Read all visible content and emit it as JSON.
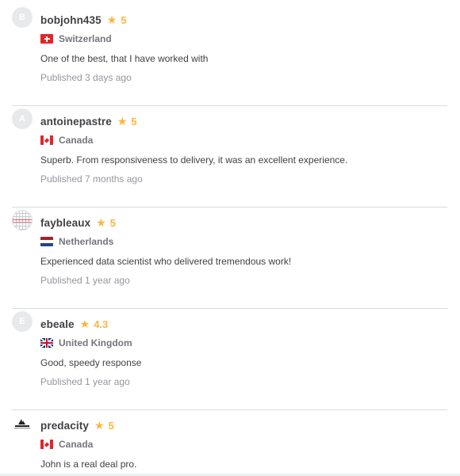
{
  "reviews": [
    {
      "avatar_letter": "B",
      "username": "bobjohn435",
      "rating": "5",
      "country": "Switzerland",
      "flag": "switzerland-flag",
      "text": "One of the best, that I have worked with",
      "published": "Published 3 days ago"
    },
    {
      "avatar_letter": "A",
      "username": "antoinepastre",
      "rating": "5",
      "country": "Canada",
      "flag": "canada-flag",
      "text": "Superb. From responsiveness to delivery, it was an excellent experience.",
      "published": "Published 7 months ago"
    },
    {
      "avatar_letter": "",
      "username": "faybleaux",
      "rating": "5",
      "country": "Netherlands",
      "flag": "netherlands-flag",
      "text": "Experienced data scientist who delivered tremendous work!",
      "published": "Published 1 year ago"
    },
    {
      "avatar_letter": "E",
      "username": "ebeale",
      "rating": "4.3",
      "country": "United Kingdom",
      "flag": "uk-flag",
      "text": "Good, speedy response",
      "published": "Published 1 year ago"
    },
    {
      "avatar_letter": "",
      "username": "predacity",
      "rating": "5",
      "country": "Canada",
      "flag": "canada-flag",
      "text": "John is a real deal pro.",
      "published": ""
    }
  ],
  "colors": {
    "star": "#ffb33e",
    "text": "#404145",
    "muted": "#95979d",
    "divider": "#dadbdd"
  },
  "icons": {
    "star": "star-icon"
  }
}
